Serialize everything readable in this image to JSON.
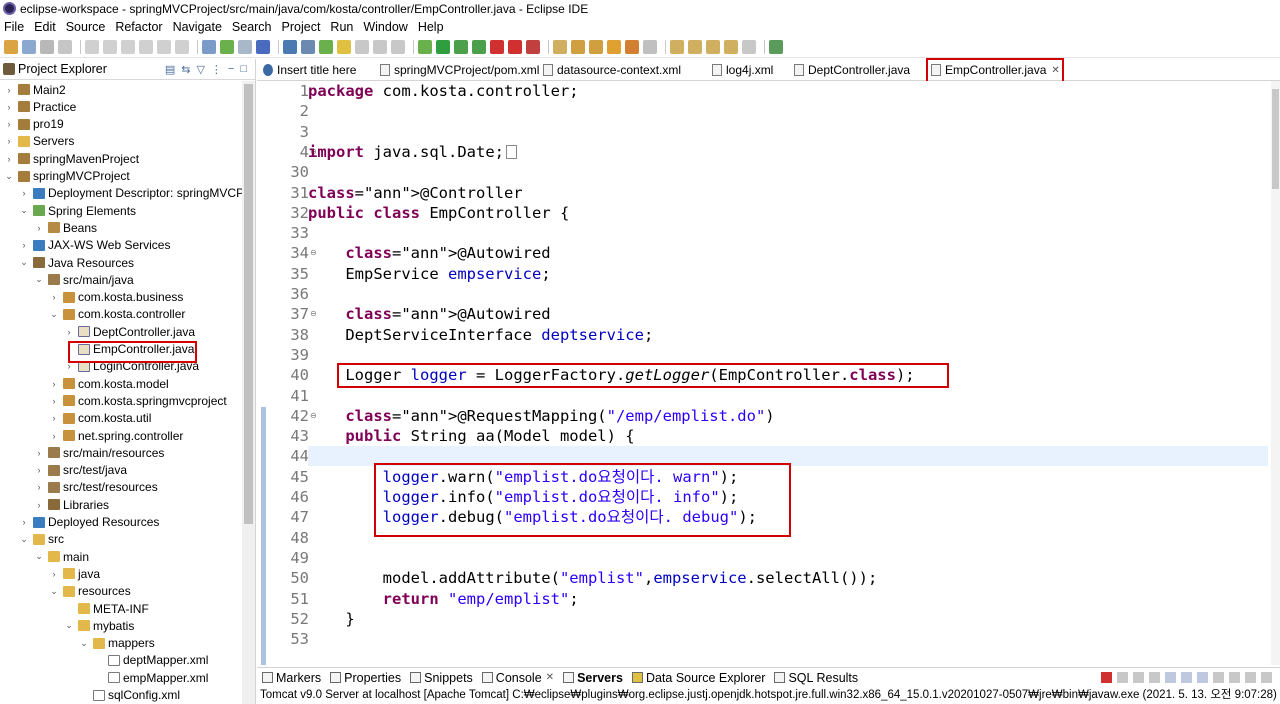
{
  "window": {
    "title": "eclipse-workspace - springMVCProject/src/main/java/com/kosta/controller/EmpController.java - Eclipse IDE"
  },
  "menu": [
    "File",
    "Edit",
    "Source",
    "Refactor",
    "Navigate",
    "Search",
    "Project",
    "Run",
    "Window",
    "Help"
  ],
  "explorer": {
    "title": "Project Explorer",
    "items": [
      {
        "label": "Main2",
        "twisty": "›",
        "icon": "project-icon"
      },
      {
        "label": "Practice",
        "twisty": "›",
        "icon": "project-icon"
      },
      {
        "label": "pro19",
        "twisty": "›",
        "icon": "project-icon"
      },
      {
        "label": "Servers",
        "twisty": "›",
        "icon": "folder-icon"
      },
      {
        "label": "springMavenProject",
        "twisty": "›",
        "icon": "project-icon"
      },
      {
        "label": "springMVCProject",
        "twisty": "⌄",
        "icon": "project-icon"
      },
      {
        "label": "Deployment Descriptor: springMVCPr",
        "twisty": "›",
        "icon": "web-icon"
      },
      {
        "label": "Spring Elements",
        "twisty": "⌄",
        "icon": "spring-icon"
      },
      {
        "label": "Beans",
        "twisty": "›",
        "icon": "beans-icon"
      },
      {
        "label": "JAX-WS Web Services",
        "twisty": "›",
        "icon": "web-icon"
      },
      {
        "label": "Java Resources",
        "twisty": "⌄",
        "icon": "library-icon"
      },
      {
        "label": "src/main/java",
        "twisty": "⌄",
        "icon": "source-folder-icon"
      },
      {
        "label": "com.kosta.business",
        "twisty": "›",
        "icon": "package-icon"
      },
      {
        "label": "com.kosta.controller",
        "twisty": "⌄",
        "icon": "package-icon"
      },
      {
        "label": "DeptController.java",
        "twisty": "›",
        "icon": "java-file-icon"
      },
      {
        "label": "EmpController.java",
        "twisty": "›",
        "icon": "java-file-icon"
      },
      {
        "label": "LoginController.java",
        "twisty": "›",
        "icon": "java-file-icon"
      },
      {
        "label": "com.kosta.model",
        "twisty": "›",
        "icon": "package-icon"
      },
      {
        "label": "com.kosta.springmvcproject",
        "twisty": "›",
        "icon": "package-icon"
      },
      {
        "label": "com.kosta.util",
        "twisty": "›",
        "icon": "package-icon"
      },
      {
        "label": "net.spring.controller",
        "twisty": "›",
        "icon": "package-icon"
      },
      {
        "label": "src/main/resources",
        "twisty": "›",
        "icon": "source-folder-icon"
      },
      {
        "label": "src/test/java",
        "twisty": "›",
        "icon": "source-folder-icon"
      },
      {
        "label": "src/test/resources",
        "twisty": "›",
        "icon": "source-folder-icon"
      },
      {
        "label": "Libraries",
        "twisty": "›",
        "icon": "library-icon"
      },
      {
        "label": "Deployed Resources",
        "twisty": "›",
        "icon": "web-icon"
      },
      {
        "label": "src",
        "twisty": "⌄",
        "icon": "folder-icon"
      },
      {
        "label": "main",
        "twisty": "⌄",
        "icon": "folder-icon"
      },
      {
        "label": "java",
        "twisty": "›",
        "icon": "folder-icon"
      },
      {
        "label": "resources",
        "twisty": "⌄",
        "icon": "folder-icon"
      },
      {
        "label": "META-INF",
        "twisty": "",
        "icon": "folder-icon"
      },
      {
        "label": "mybatis",
        "twisty": "⌄",
        "icon": "folder-icon"
      },
      {
        "label": "mappers",
        "twisty": "⌄",
        "icon": "folder-icon"
      },
      {
        "label": "deptMapper.xml",
        "twisty": "",
        "icon": "xml-file-icon"
      },
      {
        "label": "empMapper.xml",
        "twisty": "",
        "icon": "xml-file-icon"
      },
      {
        "label": "sqlConfig.xml",
        "twisty": "",
        "icon": "xml-file-icon"
      }
    ]
  },
  "editor_tabs": [
    {
      "label": "Insert title here",
      "icon": "globe-icon",
      "active": false
    },
    {
      "label": "springMVCProject/pom.xml",
      "icon": "xml-file-icon",
      "active": false
    },
    {
      "label": "datasource-context.xml",
      "icon": "xml-file-icon",
      "active": false
    },
    {
      "label": "log4j.xml",
      "icon": "xml-file-icon",
      "active": false
    },
    {
      "label": "DeptController.java",
      "icon": "java-file-icon",
      "active": false
    },
    {
      "label": "EmpController.java",
      "icon": "java-file-icon",
      "active": true,
      "close": "✕"
    }
  ],
  "code_lines": [
    {
      "no": "1",
      "text": "package com.kosta.controller;"
    },
    {
      "no": "2",
      "text": ""
    },
    {
      "no": "3",
      "text": ""
    },
    {
      "no": "4",
      "text": "import java.sql.Date;"
    },
    {
      "no": "30",
      "text": ""
    },
    {
      "no": "31",
      "text": "@Controller"
    },
    {
      "no": "32",
      "text": "public class EmpController {"
    },
    {
      "no": "33",
      "text": ""
    },
    {
      "no": "34",
      "text": "    @Autowired"
    },
    {
      "no": "35",
      "text": "    EmpService empservice;"
    },
    {
      "no": "36",
      "text": ""
    },
    {
      "no": "37",
      "text": "    @Autowired"
    },
    {
      "no": "38",
      "text": "    DeptServiceInterface deptservice;"
    },
    {
      "no": "39",
      "text": ""
    },
    {
      "no": "40",
      "text": "    Logger logger = LoggerFactory.getLogger(EmpController.class);"
    },
    {
      "no": "41",
      "text": ""
    },
    {
      "no": "42",
      "text": "    @RequestMapping(\"/emp/emplist.do\")"
    },
    {
      "no": "43",
      "text": "    public String aa(Model model) {"
    },
    {
      "no": "44",
      "text": ""
    },
    {
      "no": "45",
      "text": "        logger.warn(\"emplist.do요청이다. warn\");"
    },
    {
      "no": "46",
      "text": "        logger.info(\"emplist.do요청이다. info\");"
    },
    {
      "no": "47",
      "text": "        logger.debug(\"emplist.do요청이다. debug\");"
    },
    {
      "no": "48",
      "text": ""
    },
    {
      "no": "49",
      "text": ""
    },
    {
      "no": "50",
      "text": "        model.addAttribute(\"emplist\",empservice.selectAll());"
    },
    {
      "no": "51",
      "text": "        return \"emp/emplist\";"
    },
    {
      "no": "52",
      "text": "    }"
    },
    {
      "no": "53",
      "text": ""
    }
  ],
  "bottom_tabs": [
    {
      "label": "Markers",
      "active": false
    },
    {
      "label": "Properties",
      "active": false
    },
    {
      "label": "Snippets",
      "active": false
    },
    {
      "label": "Console",
      "active": false,
      "close": "✕"
    },
    {
      "label": "Servers",
      "active": true
    },
    {
      "label": "Data Source Explorer",
      "active": false
    },
    {
      "label": "SQL Results",
      "active": false
    }
  ],
  "console_status": "Tomcat v9.0 Server at localhost [Apache Tomcat] C:₩eclipse₩plugins₩org.eclipse.justj.openjdk.hotspot.jre.full.win32.x86_64_15.0.1.v20201027-0507₩jre₩bin₩javaw.exe  (2021. 5. 13. 오전 9:07:28)",
  "colors": {
    "keyword": "#7f0055",
    "annotation": "#646464",
    "field": "#0000c0",
    "string": "#2a00ff",
    "highlight_box": "#d40000",
    "current_line": "#e8f2fe"
  }
}
